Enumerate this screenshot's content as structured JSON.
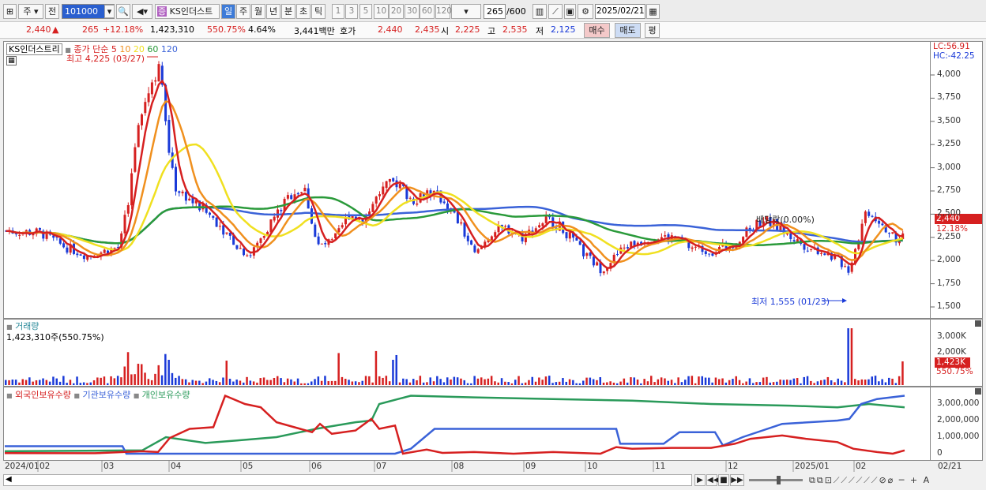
{
  "toolbar": {
    "stock_type": "주",
    "prev": "전",
    "code": "101000",
    "name": "KS인더스트",
    "periods": [
      "일",
      "주",
      "월",
      "년",
      "분",
      "초",
      "틱"
    ],
    "intervals": [
      "1",
      "3",
      "5",
      "10",
      "20",
      "30",
      "60",
      "120"
    ],
    "count": "265",
    "count_max": "/600",
    "date": "2025/02/21"
  },
  "quote": {
    "price": "2,440",
    "arrow": "▲",
    "change": "265",
    "change_pct": "+12.18%",
    "volume": "1,423,310",
    "vol_pct": "550.75%",
    "turnover": "4.64%",
    "amount": "3,441백만",
    "hoga_label": "호가",
    "hoga1": "2,440",
    "hoga2": "2,435",
    "open_label": "시",
    "open": "2,225",
    "high_label": "고",
    "high": "2,535",
    "low_label": "저",
    "low": "2,125",
    "buy": "매수",
    "sell": "매도",
    "flat": "평"
  },
  "price_chart": {
    "title": "KS인더스트리",
    "series_label": "종가 단순",
    "ma": [
      "5",
      "10",
      "20",
      "60",
      "120"
    ],
    "ma_colors": [
      "#d62020",
      "#f0901e",
      "#f0e020",
      "#2a9a3a",
      "#3a62d8"
    ],
    "high_note": "최고 4,225 (03/27)",
    "low_note": "최저 1,555 (01/23)",
    "div_note": "배당락(0.00%)",
    "yticks": [
      "4,000",
      "3,750",
      "3,500",
      "3,250",
      "3,000",
      "2,750",
      "2,500",
      "2,250",
      "2,000",
      "1,750",
      "1,500"
    ],
    "lc": "LC:56.91",
    "hc": "HC:-42.25",
    "cur_price": "2,440",
    "cur_pct": "12.18%"
  },
  "volume_chart": {
    "title": "거래량",
    "value": "1,423,310주(550.75%)",
    "yticks": [
      "3,000K",
      "2,000K"
    ],
    "cur": "1,423K",
    "cur_pct": "550.75%"
  },
  "holdings_chart": {
    "legend": [
      "외국인보유수량",
      "기관보유수량",
      "개인보유수량"
    ],
    "colors": [
      "#d62020",
      "#3a62d8",
      "#2a9a5a"
    ],
    "yticks": [
      "3,000,000",
      "2,000,000",
      "1,000,000",
      "0"
    ]
  },
  "x_labels": [
    "2024/01",
    "02",
    "03",
    "04",
    "05",
    "06",
    "07",
    "08",
    "09",
    "10",
    "11",
    "12",
    "2025/01",
    "02",
    "02/21"
  ]
}
